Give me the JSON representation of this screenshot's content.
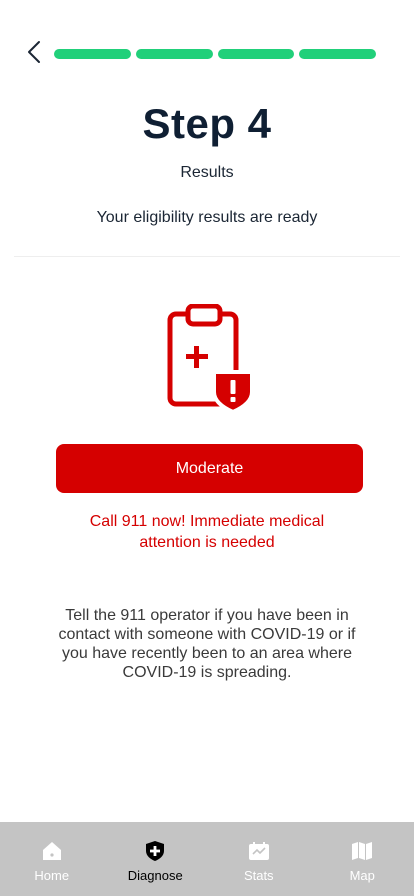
{
  "header": {
    "progress_steps": 4,
    "progress_completed": 4,
    "progress_color": "#21d07a"
  },
  "title": "Step 4",
  "subtitle": "Results",
  "description": "Your eligibility results are ready",
  "result": {
    "icon": "clipboard-medical-alert-icon",
    "severity_label": "Moderate",
    "severity_color": "#d50000",
    "alert": "Call 911 now! Immediate medical attention is needed",
    "advice": "Tell the 911 operator if you have been in contact with someone with COVID-19 or if you have recently been to an area where COVID-19 is spreading."
  },
  "tabbar": {
    "tabs": [
      {
        "label": "Home",
        "icon": "home-icon",
        "active": false
      },
      {
        "label": "Diagnose",
        "icon": "shield-plus-icon",
        "active": true
      },
      {
        "label": "Stats",
        "icon": "stats-icon",
        "active": false
      },
      {
        "label": "Map",
        "icon": "map-icon",
        "active": false
      }
    ]
  }
}
